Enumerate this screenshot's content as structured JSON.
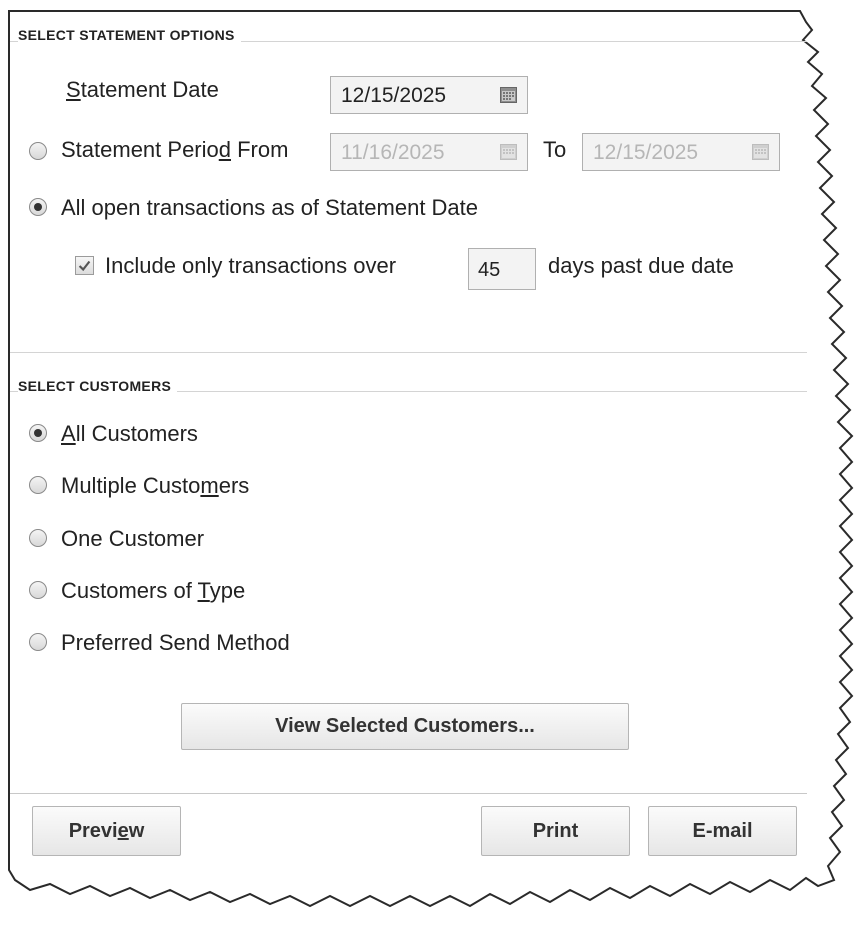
{
  "statement_options": {
    "header": "SELECT STATEMENT OPTIONS",
    "statement_date": {
      "label_pre": "",
      "label_u": "S",
      "label_post": "tatement Date",
      "value": "12/15/2025"
    },
    "period": {
      "label_pre": "Statement Perio",
      "label_u": "d",
      "label_post": " From",
      "from": "11/16/2025",
      "to_label": "To",
      "to": "12/15/2025",
      "selected": false
    },
    "open_transactions": {
      "label": "All open transactions as of Statement Date",
      "selected": true
    },
    "include_only": {
      "label": "Include only transactions over",
      "days": "45",
      "suffix": "days past due date",
      "checked": true
    }
  },
  "customers": {
    "header": "SELECT CUSTOMERS",
    "options": [
      {
        "pre": "",
        "u": "A",
        "post": "ll Customers",
        "selected": true
      },
      {
        "pre": "Multiple Custo",
        "u": "m",
        "post": "ers",
        "selected": false
      },
      {
        "pre": "One Customer",
        "u": "",
        "post": "",
        "selected": false
      },
      {
        "pre": "Customers of ",
        "u": "T",
        "post": "ype",
        "selected": false
      },
      {
        "pre": "Preferred Send Method",
        "u": "",
        "post": "",
        "selected": false
      }
    ],
    "view_button": "View Selected Customers..."
  },
  "footer": {
    "preview": {
      "pre": "Previ",
      "u": "e",
      "post": "w"
    },
    "print": "Print",
    "email": "E-mail"
  }
}
